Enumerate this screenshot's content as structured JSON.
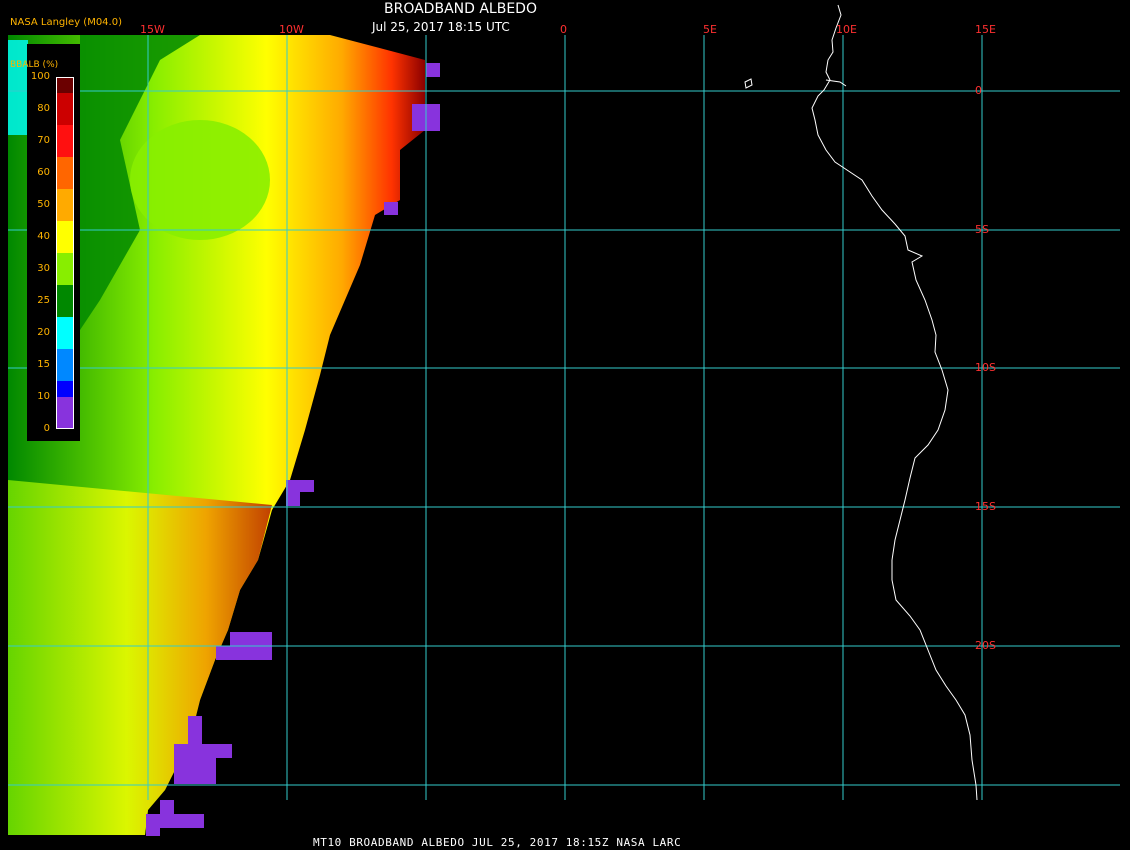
{
  "header": {
    "credit": "NASA Langley (M04.0)",
    "title": "BROADBAND ALBEDO",
    "datetime": "Jul 25, 2017 18:15 UTC"
  },
  "footer": "MT10  BROADBAND ALBEDO   JUL 25, 2017 18:15Z   NASA LARC",
  "grid": {
    "lon_labels": [
      "15W",
      "10W",
      "0",
      "5E",
      "10E",
      "15E"
    ],
    "lat_labels": [
      "0",
      "5S",
      "10S",
      "15S",
      "20S"
    ],
    "line_color": "#33cccc",
    "label_color": "#ff3030"
  },
  "legend": {
    "title": "BBALB (%)",
    "ticks": [
      "100",
      "80",
      "70",
      "60",
      "50",
      "40",
      "30",
      "25",
      "20",
      "15",
      "10",
      "0"
    ],
    "colors": [
      "#6b0000",
      "#cc0000",
      "#ff1010",
      "#ff6600",
      "#ffaa00",
      "#ffff00",
      "#88ee00",
      "#008800",
      "#00ffff",
      "#0088ff",
      "#0000ff",
      "#8833dd"
    ]
  },
  "colors": {
    "coastline": "#ffffff",
    "background": "#000000",
    "no_data": "#8833dd"
  }
}
